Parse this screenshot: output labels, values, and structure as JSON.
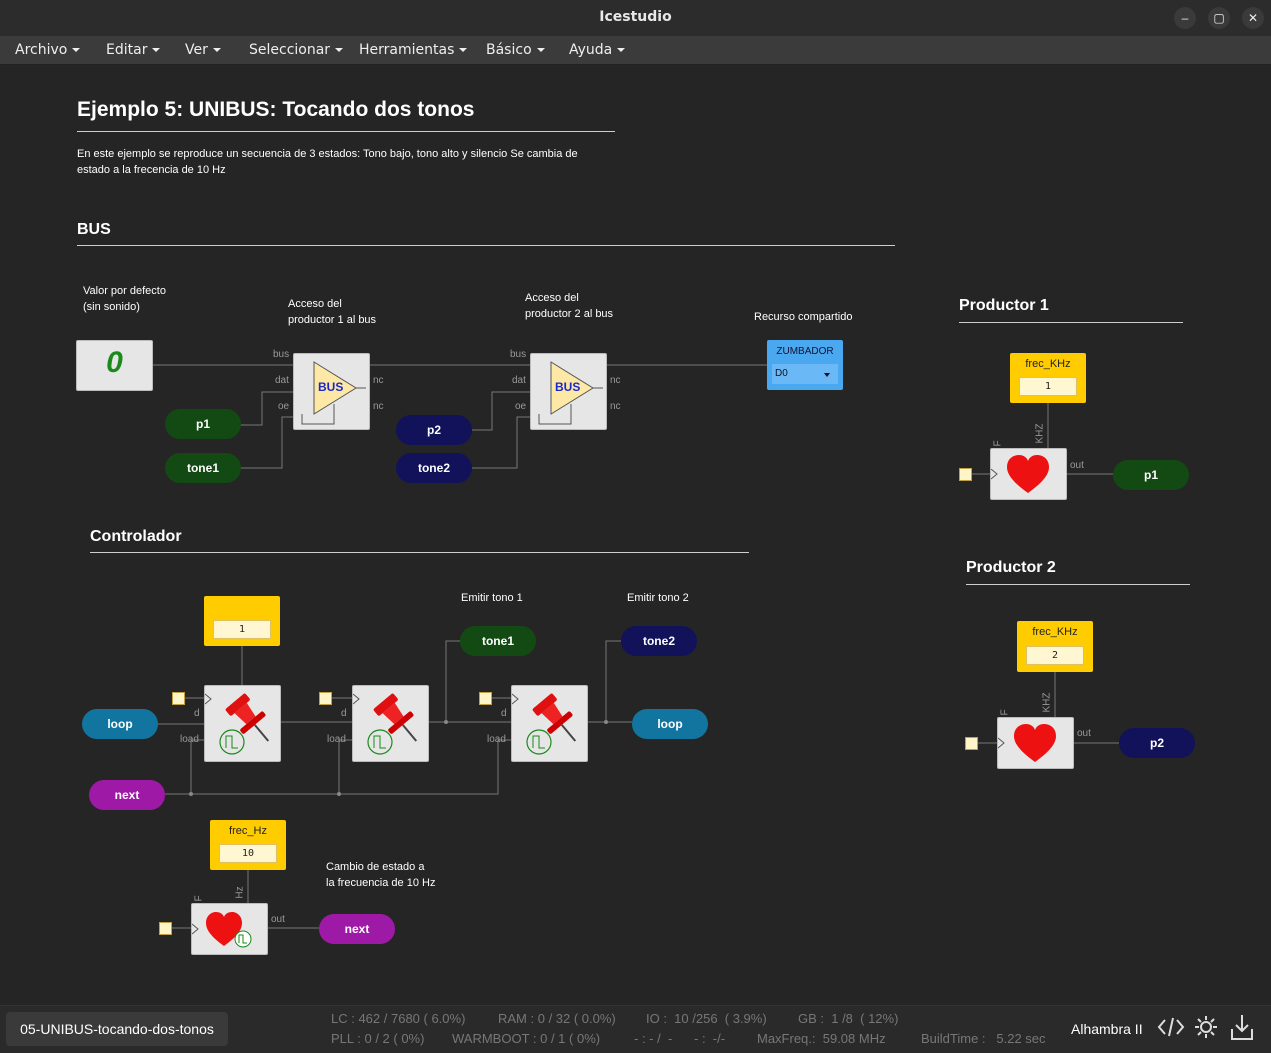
{
  "window": {
    "title": "Icestudio"
  },
  "window_controls": {
    "minimize": "–",
    "maximize": "▢",
    "close": "✕"
  },
  "menu": [
    "Archivo",
    "Editar",
    "Ver",
    "Seleccionar",
    "Herramientas",
    "Básico",
    "Ayuda"
  ],
  "doc": {
    "title": "Ejemplo 5: UNIBUS: Tocando dos tonos",
    "desc1": "En este ejemplo se reproduce un secuencia de 3 estados: Tono bajo, tono alto y silencio Se cambia de",
    "desc2": "estado a la frecencia de 10 Hz"
  },
  "sections": {
    "bus": "BUS",
    "controlador": "Controlador",
    "productor1": "Productor 1",
    "productor2": "Productor 2"
  },
  "notes": {
    "valor1": "Valor por defecto",
    "valor2": "(sin sonido)",
    "acceso1_1": "Acceso del",
    "acceso1_2": "productor 1 al bus",
    "acceso2_1": "Acceso del",
    "acceso2_2": "productor 2 al bus",
    "recurso": "Recurso compartido",
    "emitir1": "Emitir tono 1",
    "emitir2": "Emitir tono 2",
    "cambio1": "Cambio de estado a",
    "cambio2": "la frecuencia de 10 Hz"
  },
  "blocks": {
    "zero": "0",
    "bus_label": "BUS",
    "zumbador": "ZUMBADOR",
    "zumbador_pin": "D0",
    "pins": {
      "bus": "bus",
      "dat": "dat",
      "oe": "oe",
      "nc": "nc",
      "d": "d",
      "load": "load",
      "out": "out",
      "F": "F",
      "KHZ": "KHZ",
      "Hz": "Hz"
    }
  },
  "labels": {
    "p1": "p1",
    "p2": "p2",
    "tone1": "tone1",
    "tone2": "tone2",
    "loop": "loop",
    "next": "next"
  },
  "constants": {
    "reg_init": {
      "value": "1"
    },
    "frec_hz": {
      "label": "frec_Hz",
      "value": "10"
    },
    "frec_khz1": {
      "label": "frec_KHz",
      "value": "1"
    },
    "frec_khz2": {
      "label": "frec_KHz",
      "value": "2"
    }
  },
  "status": {
    "file": "05-UNIBUS-tocando-dos-tonos",
    "lc": "LC : 462 / 7680 ( 6.0%)",
    "ram": "RAM : 0 / 32 ( 0.0%)",
    "io": "IO :  10 /256  ( 3.9%)",
    "gb": "GB :  1 /8  ( 12%)",
    "pll": "PLL : 0 / 2 ( 0%)",
    "warmboot": "WARMBOOT : 0 / 1 ( 0%)",
    "dash1": "- : - /  -",
    "dash2": "- :  -/-",
    "maxfreq": "MaxFreq.:  59.08 MHz",
    "buildtime": "BuildTime :   5.22 sec",
    "board": "Alhambra II"
  },
  "colors": {
    "bg": "#252525",
    "constant": "#ffcc00",
    "zumbador": "#4aa8f0",
    "green": "#134a14",
    "navy": "#12125a",
    "teal": "#1175a0",
    "purple": "#9e1aa6"
  }
}
